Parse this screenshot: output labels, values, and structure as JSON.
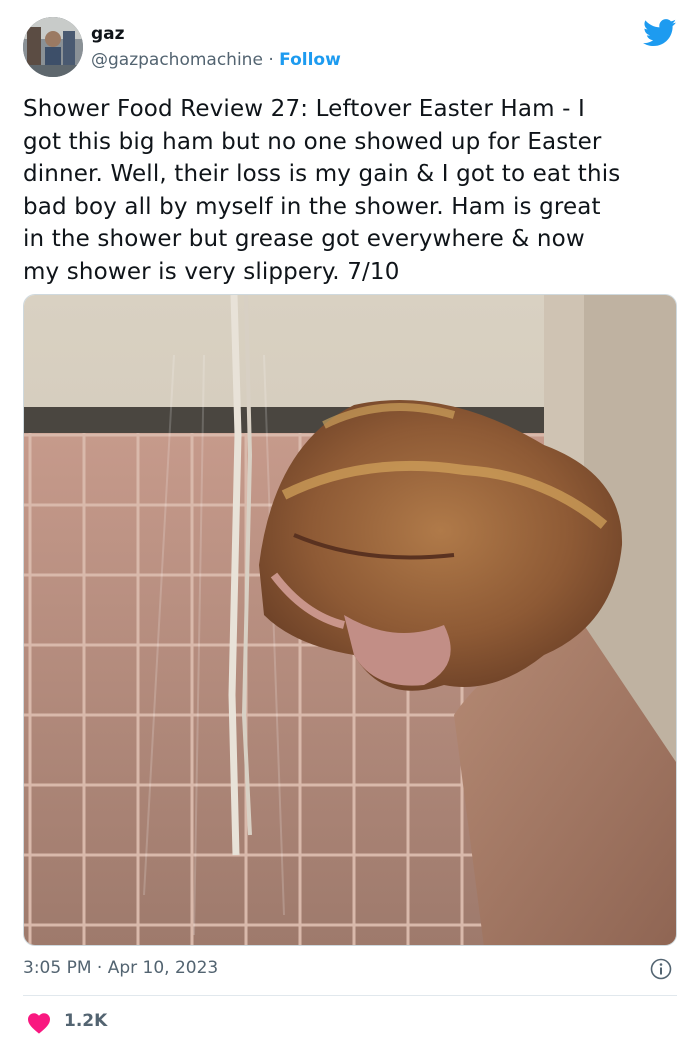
{
  "author": {
    "name": "gaz",
    "handle": "@gazpachomachine",
    "separator": "·",
    "follow_label": "Follow"
  },
  "tweet": {
    "text": "Shower Food Review 27: Leftover Easter Ham - I\ngot this big ham but no one showed up for Easter\ndinner. Well, their loss is my gain & I got to eat this\nbad boy all by myself in the shower. Ham is great\nin the shower but grease got everywhere & now\nmy shower is very slippery. 7/10",
    "time": "3:05 PM",
    "date_separator": "·",
    "date": "Apr 10, 2023",
    "likes": "1.2K"
  },
  "icons": {
    "brand": "twitter-bird-icon",
    "info": "info-icon",
    "like": "heart-icon"
  },
  "colors": {
    "accent": "#1d9bf0",
    "like": "#f91880",
    "secondary_text": "#536471"
  }
}
